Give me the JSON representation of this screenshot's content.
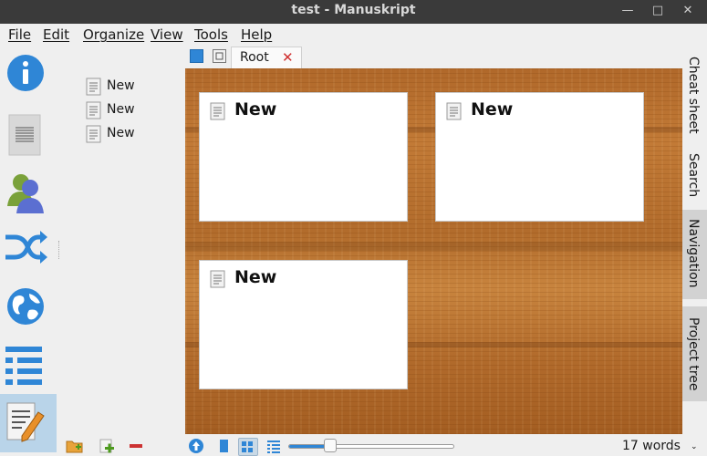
{
  "window": {
    "title": "test - Manuskript"
  },
  "menu": [
    "File",
    "Edit",
    "Organize",
    "View",
    "Tools",
    "Help"
  ],
  "sidebar_icons": [
    "info-icon",
    "summary-icon",
    "characters-icon",
    "plots-icon",
    "world-icon",
    "outline-icon",
    "editor-icon"
  ],
  "tree": {
    "items": [
      "New",
      "New",
      "New"
    ]
  },
  "tabs": [
    {
      "label": "Root",
      "close": "✕"
    }
  ],
  "cards": [
    {
      "title": "New"
    },
    {
      "title": "New"
    },
    {
      "title": "New"
    }
  ],
  "right_tabs": [
    "Cheat sheet",
    "Search",
    "Navigation",
    "Project tree"
  ],
  "status": {
    "word_count": "17 words",
    "zoom_fraction": 0.25,
    "chevron": "⌄"
  },
  "colors": {
    "accent": "#2f86d6",
    "title_bg": "#3a3a3a",
    "close_red": "#d03030",
    "cork": "#b87230"
  }
}
